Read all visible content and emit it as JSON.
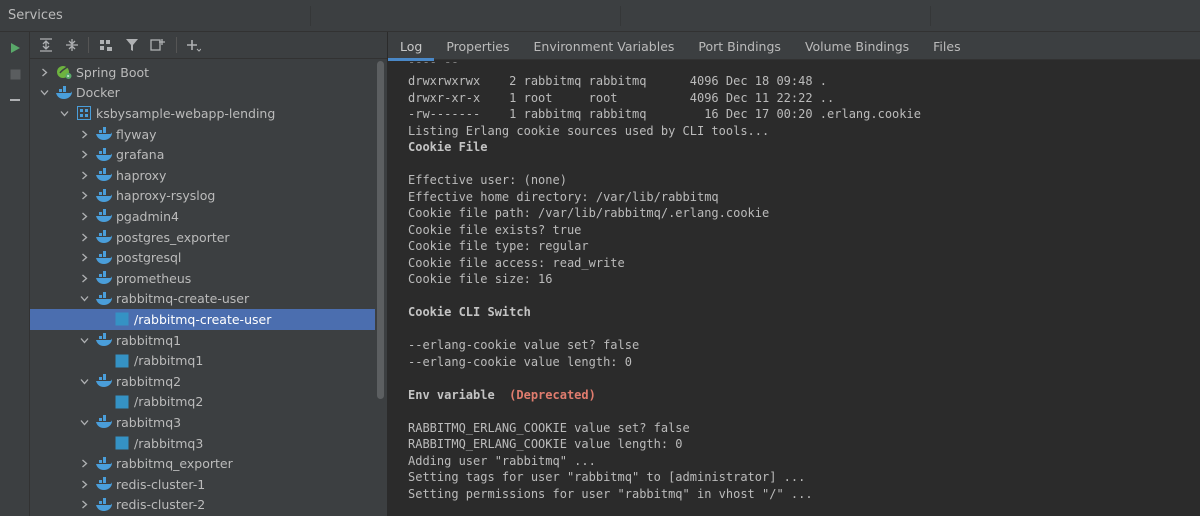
{
  "window": {
    "title": "Services"
  },
  "vtool": [
    {
      "name": "run-icon",
      "color": "#59a869"
    },
    {
      "name": "stop-icon",
      "color": "#5a5d5f"
    },
    {
      "name": "minimize-icon",
      "color": "#afb1b3"
    }
  ],
  "tree_toolbar": [
    "expand-all-icon",
    "collapse-all-icon",
    "group-icon",
    "filter-icon",
    "new-service-icon",
    "add-icon"
  ],
  "tree": [
    {
      "label": "Spring Boot",
      "depth": 0,
      "chevron": "right",
      "icon": "spring-boot-icon"
    },
    {
      "label": "Docker",
      "depth": 0,
      "chevron": "down",
      "icon": "docker-icon"
    },
    {
      "label": "ksbysample-webapp-lending",
      "depth": 1,
      "chevron": "down",
      "icon": "compose-icon"
    },
    {
      "label": "flyway",
      "depth": 2,
      "chevron": "right",
      "icon": "docker-icon"
    },
    {
      "label": "grafana",
      "depth": 2,
      "chevron": "right",
      "icon": "docker-icon"
    },
    {
      "label": "haproxy",
      "depth": 2,
      "chevron": "right",
      "icon": "docker-icon"
    },
    {
      "label": "haproxy-rsyslog",
      "depth": 2,
      "chevron": "right",
      "icon": "docker-icon"
    },
    {
      "label": "pgadmin4",
      "depth": 2,
      "chevron": "right",
      "icon": "docker-icon"
    },
    {
      "label": "postgres_exporter",
      "depth": 2,
      "chevron": "right",
      "icon": "docker-icon"
    },
    {
      "label": "postgresql",
      "depth": 2,
      "chevron": "right",
      "icon": "docker-icon"
    },
    {
      "label": "prometheus",
      "depth": 2,
      "chevron": "right",
      "icon": "docker-icon"
    },
    {
      "label": "rabbitmq-create-user",
      "depth": 2,
      "chevron": "down",
      "icon": "docker-icon"
    },
    {
      "label": "/rabbitmq-create-user",
      "depth": 3,
      "chevron": "none",
      "icon": "container-icon",
      "selected": true
    },
    {
      "label": "rabbitmq1",
      "depth": 2,
      "chevron": "down",
      "icon": "docker-icon"
    },
    {
      "label": "/rabbitmq1",
      "depth": 3,
      "chevron": "none",
      "icon": "container-icon"
    },
    {
      "label": "rabbitmq2",
      "depth": 2,
      "chevron": "down",
      "icon": "docker-icon"
    },
    {
      "label": "/rabbitmq2",
      "depth": 3,
      "chevron": "none",
      "icon": "container-icon"
    },
    {
      "label": "rabbitmq3",
      "depth": 2,
      "chevron": "down",
      "icon": "docker-icon"
    },
    {
      "label": "/rabbitmq3",
      "depth": 3,
      "chevron": "none",
      "icon": "container-icon"
    },
    {
      "label": "rabbitmq_exporter",
      "depth": 2,
      "chevron": "right",
      "icon": "docker-icon"
    },
    {
      "label": "redis-cluster-1",
      "depth": 2,
      "chevron": "right",
      "icon": "docker-icon"
    },
    {
      "label": "redis-cluster-2",
      "depth": 2,
      "chevron": "right",
      "icon": "docker-icon"
    }
  ],
  "tabs": [
    {
      "label": "Log",
      "active": true
    },
    {
      "label": "Properties"
    },
    {
      "label": "Environment Variables"
    },
    {
      "label": "Port Bindings"
    },
    {
      "label": "Volume Bindings"
    },
    {
      "label": "Files"
    }
  ],
  "log": [
    {
      "text": "drwxrwxrwx    2 rabbitmq rabbitmq      4096 Dec 18 09:48 ."
    },
    {
      "text": "drwxr-xr-x    1 root     root          4096 Dec 11 22:22 .."
    },
    {
      "text": "-rw-------    1 rabbitmq rabbitmq        16 Dec 17 00:20 .erlang.cookie"
    },
    {
      "text": "Listing Erlang cookie sources used by CLI tools..."
    },
    {
      "text": "Cookie File",
      "bold": true
    },
    {
      "text": ""
    },
    {
      "text": "Effective user: (none)"
    },
    {
      "text": "Effective home directory: /var/lib/rabbitmq"
    },
    {
      "text": "Cookie file path: /var/lib/rabbitmq/.erlang.cookie"
    },
    {
      "text": "Cookie file exists? true"
    },
    {
      "text": "Cookie file type: regular"
    },
    {
      "text": "Cookie file access: read_write"
    },
    {
      "text": "Cookie file size: 16"
    },
    {
      "text": ""
    },
    {
      "text": "Cookie CLI Switch",
      "bold": true
    },
    {
      "text": ""
    },
    {
      "text": "--erlang-cookie value set? false"
    },
    {
      "text": "--erlang-cookie value length: 0"
    },
    {
      "text": ""
    },
    {
      "text": "Env variable",
      "bold": true,
      "suffix": "(Deprecated)"
    },
    {
      "text": ""
    },
    {
      "text": "RABBITMQ_ERLANG_COOKIE value set? false"
    },
    {
      "text": "RABBITMQ_ERLANG_COOKIE value length: 0"
    },
    {
      "text": "Adding user \"rabbitmq\" ..."
    },
    {
      "text": "Setting tags for user \"rabbitmq\" to [administrator] ..."
    },
    {
      "text": "Setting permissions for user \"rabbitmq\" in vhost \"/\" ..."
    }
  ],
  "colors": {
    "accent": "#4a88c7",
    "selection": "#4b6eaf",
    "docker": "#4a9eda",
    "container": "#3592c4",
    "deprecated": "#e07c6e",
    "spring": "#6db33f"
  }
}
